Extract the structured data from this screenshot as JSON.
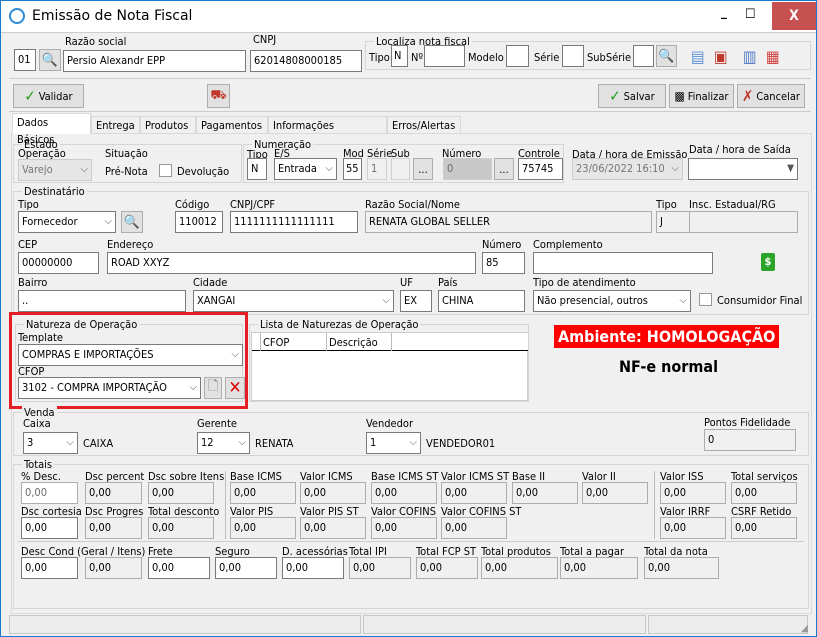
{
  "window": {
    "title": "Emissão de Nota Fiscal",
    "controls": {
      "minimize": "_",
      "maximize": "☐",
      "close": "X"
    }
  },
  "header": {
    "code": "01",
    "razao_social_label": "Razão social",
    "razao_social": "Persio Alexandr EPP",
    "cnpj_label": "CNPJ",
    "cnpj": "62014808000185",
    "localiza": {
      "title": "Localiza nota fiscal",
      "tipo_label": "Tipo",
      "tipo": "N",
      "numero_label": "Nº",
      "numero": "",
      "modelo_label": "Modelo",
      "modelo": "",
      "serie_label": "Série",
      "serie": "",
      "subserie_label": "SubSérie",
      "subserie": ""
    }
  },
  "toolbar": {
    "validar": "Validar",
    "salvar": "Salvar",
    "finalizar": "Finalizar",
    "cancelar": "Cancelar"
  },
  "tabs": [
    {
      "label": "Dados Básicos",
      "active": true
    },
    {
      "label": "Entrega"
    },
    {
      "label": "Produtos"
    },
    {
      "label": "Pagamentos"
    },
    {
      "label": "Informações Adicionais"
    },
    {
      "label": "Erros/Alertas"
    }
  ],
  "estado": {
    "title": "Estado",
    "operacao_label": "Operação",
    "operacao": "Varejo",
    "situacao_label": "Situação",
    "situacao": "Pré-Nota",
    "devolucao_label": "Devolução",
    "devolucao": false
  },
  "numeracao": {
    "title": "Numeração",
    "tipo_label": "Tipo",
    "tipo": "N",
    "es_label": "E/S",
    "es": "Entrada",
    "mod_label": "Mod",
    "mod": "55",
    "serie_label": "Série",
    "serie": "1",
    "sub_label": "Sub",
    "sub": "",
    "numero_label": "Número",
    "numero": "0",
    "controle_label": "Controle",
    "controle": "75745",
    "ellipsis": "..."
  },
  "datas": {
    "emissao_label": "Data / hora de Emissão",
    "emissao": "23/06/2022 16:10",
    "saida_label": "Data / hora de Saída",
    "saida": ""
  },
  "destinatario": {
    "title": "Destinatário",
    "tipo_label": "Tipo",
    "tipo": "Fornecedor",
    "codigo_label": "Código",
    "codigo": "110012",
    "cnpj_label": "CNPJ/CPF",
    "cnpj": "1111111111111111",
    "razao_label": "Razão Social/Nome",
    "razao": "RENATA GLOBAL SELLER",
    "tipo2_label": "Tipo",
    "tipo2": "J",
    "ie_label": "Insc. Estadual/RG",
    "ie": "",
    "cep_label": "CEP",
    "cep": "00000000",
    "endereco_label": "Endereço",
    "endereco": "ROAD XXYZ",
    "numero_label": "Número",
    "numero": "85",
    "complemento_label": "Complemento",
    "complemento": "",
    "bairro_label": "Bairro",
    "bairro": "..",
    "cidade_label": "Cidade",
    "cidade": "XANGAI",
    "uf_label": "UF",
    "uf": "EX",
    "pais_label": "País",
    "pais": "CHINA",
    "atendimento_label": "Tipo de atendimento",
    "atendimento": "Não presencial, outros",
    "consumidor_final_label": "Consumidor Final",
    "consumidor_final": false
  },
  "natureza": {
    "title": "Natureza de Operação",
    "template_label": "Template",
    "template": "COMPRAS E IMPORTAÇÕES",
    "cfop_label": "CFOP",
    "cfop": "3102  - COMPRA IMPORTAÇÃO",
    "highlight_color": "#e31e24"
  },
  "lista_naturezas": {
    "title": "Lista de Naturezas de Operação",
    "columns": [
      "CFOP",
      "Descrição"
    ],
    "rows": []
  },
  "ambiente": {
    "label": "Ambiente: HOMOLOGAÇÃO",
    "color": "#ff0000",
    "nfe_tipo": "NF-e normal"
  },
  "venda": {
    "title": "Venda",
    "caixa_label": "Caixa",
    "caixa": "3",
    "caixa_nome": "CAIXA",
    "gerente_label": "Gerente",
    "gerente": "12",
    "gerente_nome": "RENATA",
    "vendedor_label": "Vendedor",
    "vendedor": "1",
    "vendedor_nome": "VENDEDOR01",
    "pontos_label": "Pontos Fidelidade",
    "pontos": "0"
  },
  "totais": {
    "title": "Totais",
    "fields": [
      {
        "label": "% Desc.",
        "value": "0,00"
      },
      {
        "label": "Dsc percent",
        "value": "0,00"
      },
      {
        "label": "Dsc sobre Itens",
        "value": "0,00"
      },
      {
        "label": "Base ICMS",
        "value": "0,00"
      },
      {
        "label": "Valor ICMS",
        "value": "0,00"
      },
      {
        "label": "Base ICMS ST",
        "value": "0,00"
      },
      {
        "label": "Valor ICMS ST",
        "value": "0,00"
      },
      {
        "label": "Base II",
        "value": "0,00"
      },
      {
        "label": "Valor II",
        "value": "0,00"
      },
      {
        "label": "Valor ISS",
        "value": "0,00"
      },
      {
        "label": "Total serviços",
        "value": "0,00"
      },
      {
        "label": "Dsc cortesia",
        "value": "0,00"
      },
      {
        "label": "Dsc Progres",
        "value": "0,00"
      },
      {
        "label": "Total desconto",
        "value": "0,00"
      },
      {
        "label": "Valor PIS",
        "value": "0,00"
      },
      {
        "label": "Valor PIS ST",
        "value": "0,00"
      },
      {
        "label": "Valor COFINS",
        "value": "0,00"
      },
      {
        "label": "Valor COFINS ST",
        "value": "0,00"
      },
      {
        "label": "Valor IRRF",
        "value": "0,00"
      },
      {
        "label": "CSRF Retido",
        "value": "0,00"
      },
      {
        "label": "Desc Cond (Geral / Itens)",
        "value": "0,00",
        "value2": "0,00"
      },
      {
        "label": "Frete",
        "value": "0,00"
      },
      {
        "label": "Seguro",
        "value": "0,00"
      },
      {
        "label": "D. acessórias",
        "value": "0,00"
      },
      {
        "label": "Total IPI",
        "value": "0,00"
      },
      {
        "label": "Total FCP ST",
        "value": "0,00"
      },
      {
        "label": "Total produtos",
        "value": "0,00"
      },
      {
        "label": "Total a pagar",
        "value": "0,00"
      },
      {
        "label": "Total da nota",
        "value": "0,00"
      }
    ]
  },
  "statusbar": [
    "",
    "",
    ""
  ]
}
